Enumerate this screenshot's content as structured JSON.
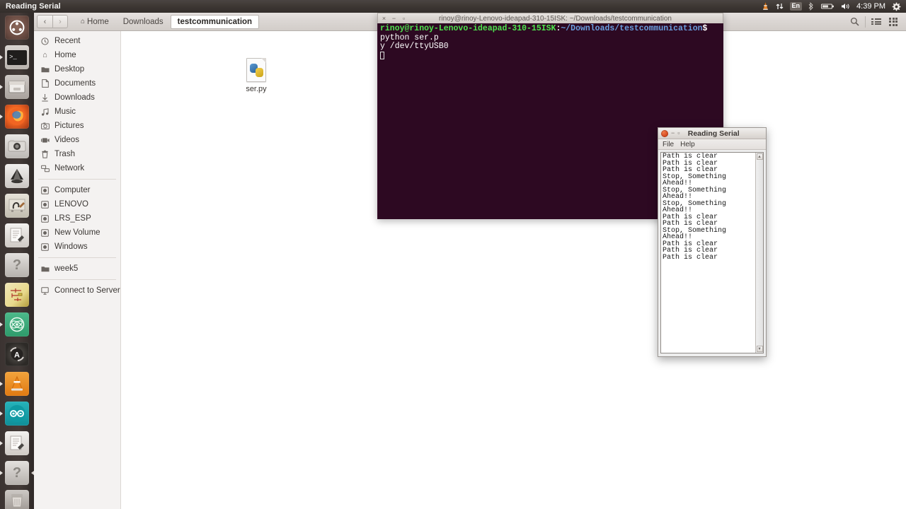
{
  "panel": {
    "title": "Reading Serial",
    "indicators": [
      {
        "name": "vlc-tray-icon",
        "glyph": "▲"
      },
      {
        "name": "network-icon",
        "glyph": "⇅"
      },
      {
        "name": "keyboard-layout-indicator",
        "label": "En"
      },
      {
        "name": "bluetooth-icon",
        "glyph": "✳"
      },
      {
        "name": "battery-icon",
        "glyph": "▭"
      },
      {
        "name": "volume-icon",
        "glyph": "🔊"
      }
    ],
    "clock": "4:39 PM",
    "session_menu_icon": "gear-icon"
  },
  "launcher": {
    "items": [
      {
        "name": "ubuntu-dash",
        "label": "Ubuntu Dash",
        "running": false
      },
      {
        "name": "terminal",
        "label": "Terminal",
        "running": true
      },
      {
        "name": "files",
        "label": "Files",
        "running": true
      },
      {
        "name": "firefox",
        "label": "Firefox",
        "running": true
      },
      {
        "name": "cheese-camera",
        "label": "Cheese",
        "running": false
      },
      {
        "name": "inkscape",
        "label": "Inkscape",
        "running": false
      },
      {
        "name": "gimp",
        "label": "GIMP",
        "running": false
      },
      {
        "name": "text-editor",
        "label": "Text Editor",
        "running": false
      },
      {
        "name": "help",
        "label": "Help",
        "running": false
      },
      {
        "name": "schematic-editor",
        "label": "Schematic Editor",
        "running": false
      },
      {
        "name": "proteus-atom",
        "label": "Proteus",
        "running": true
      },
      {
        "name": "autodesk-app",
        "label": "Autodesk",
        "running": false
      },
      {
        "name": "vlc",
        "label": "VLC Media Player",
        "running": true
      },
      {
        "name": "arduino-ide",
        "label": "Arduino IDE",
        "running": true
      },
      {
        "name": "writer-editor",
        "label": "Editor",
        "running": true
      },
      {
        "name": "help-secondary",
        "label": "Help",
        "running": true
      },
      {
        "name": "trash",
        "label": "Trash",
        "running": false
      }
    ]
  },
  "file_manager": {
    "nav": {
      "back": "‹",
      "forward": "›"
    },
    "breadcrumbs": [
      {
        "label": "Home",
        "icon": "home-icon",
        "active": false
      },
      {
        "label": "Downloads",
        "icon": "",
        "active": false
      },
      {
        "label": "testcommunication",
        "icon": "",
        "active": true
      }
    ],
    "toolbar_right": [
      {
        "name": "search-icon",
        "glyph": "⌕"
      },
      {
        "name": "list-view-icon"
      },
      {
        "name": "grid-view-icon"
      }
    ],
    "sidebar": {
      "places": [
        {
          "label": "Recent",
          "icon": "clock-icon"
        },
        {
          "label": "Home",
          "icon": "home-icon"
        },
        {
          "label": "Desktop",
          "icon": "folder-icon"
        },
        {
          "label": "Documents",
          "icon": "document-icon"
        },
        {
          "label": "Downloads",
          "icon": "download-icon"
        },
        {
          "label": "Music",
          "icon": "music-icon"
        },
        {
          "label": "Pictures",
          "icon": "camera-icon"
        },
        {
          "label": "Videos",
          "icon": "video-icon"
        },
        {
          "label": "Trash",
          "icon": "trash-icon"
        },
        {
          "label": "Network",
          "icon": "network-icon"
        }
      ],
      "devices": [
        {
          "label": "Computer",
          "icon": "drive-icon"
        },
        {
          "label": "LENOVO",
          "icon": "drive-icon"
        },
        {
          "label": "LRS_ESP",
          "icon": "drive-icon"
        },
        {
          "label": "New Volume",
          "icon": "drive-icon"
        },
        {
          "label": "Windows",
          "icon": "drive-icon"
        }
      ],
      "bookmarks": [
        {
          "label": "week5",
          "icon": "folder-icon"
        }
      ],
      "network": [
        {
          "label": "Connect to Server",
          "icon": "server-icon"
        }
      ]
    },
    "files": [
      {
        "label": "ser.py",
        "type": "python-file"
      }
    ]
  },
  "terminal": {
    "title": "rinoy@rinoy-Lenovo-ideapad-310-15ISK: ~/Downloads/testcommunication",
    "buttons": {
      "close": "×",
      "minimize": "−",
      "maximize": "▫"
    },
    "prompt_user": "rinoy@rinoy-Lenovo-ideapad-310-15ISK",
    "prompt_colon": ":",
    "prompt_path": "~/Downloads/testcommunication",
    "prompt_dollar": "$",
    "command": " python ser.p",
    "command_wrap": "y /dev/ttyUSB0"
  },
  "serial_window": {
    "title": "Reading Serial",
    "buttons": {
      "close": "",
      "minimize": "−",
      "maximize": "▫"
    },
    "menu": [
      {
        "label": "File"
      },
      {
        "label": "Help"
      }
    ],
    "lines": [
      "Path is clear",
      "Path is clear",
      "Path is clear",
      "Stop, Something Ahead!!",
      "Stop, Something Ahead!!",
      "Stop, Something Ahead!!",
      "Path is clear",
      "Path is clear",
      "Stop, Something Ahead!!",
      "Path is clear",
      "Path is clear",
      "Path is clear"
    ],
    "scrollbar": {
      "up": "▲",
      "down": "▼"
    }
  },
  "colors": {
    "panel_bg": "#3d3733",
    "launcher_bg": "#443b38",
    "terminal_bg": "#2d0922",
    "prompt_green": "#4ee44e",
    "prompt_blue": "#6a9fe0",
    "desktop_bg": "#ffffff"
  }
}
